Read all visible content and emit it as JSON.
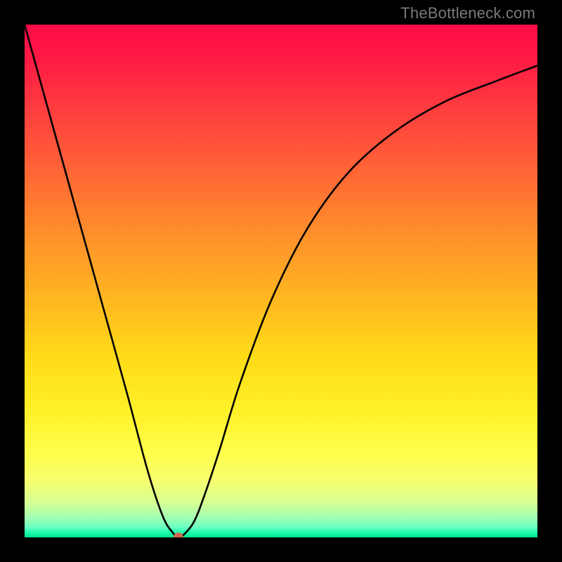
{
  "watermark": "TheBottleneck.com",
  "chart_data": {
    "type": "line",
    "title": "",
    "xlabel": "",
    "ylabel": "",
    "xlim": [
      0,
      100
    ],
    "ylim": [
      0,
      100
    ],
    "grid": false,
    "background_gradient": {
      "orientation": "vertical",
      "stops": [
        {
          "pos": 0.0,
          "color": "#ff0b47"
        },
        {
          "pos": 0.3,
          "color": "#ff6a34"
        },
        {
          "pos": 0.54,
          "color": "#ffb81f"
        },
        {
          "pos": 0.76,
          "color": "#fff22a"
        },
        {
          "pos": 0.93,
          "color": "#d9ff92"
        },
        {
          "pos": 1.0,
          "color": "#00e28a"
        }
      ]
    },
    "series": [
      {
        "name": "bottleneck-curve",
        "x": [
          0,
          5,
          10,
          15,
          20,
          24,
          27,
          29,
          30,
          31,
          33,
          35,
          38,
          42,
          48,
          55,
          63,
          72,
          82,
          92,
          100
        ],
        "y": [
          100,
          82,
          64,
          46,
          28,
          13,
          4,
          0.8,
          0,
          0.5,
          3,
          8,
          17,
          30,
          46,
          60,
          71,
          79,
          85,
          89,
          92
        ]
      }
    ],
    "marker": {
      "name": "minimum-point",
      "x": 30,
      "y": 0,
      "color": "#d36a56",
      "radius_px": 7
    }
  }
}
